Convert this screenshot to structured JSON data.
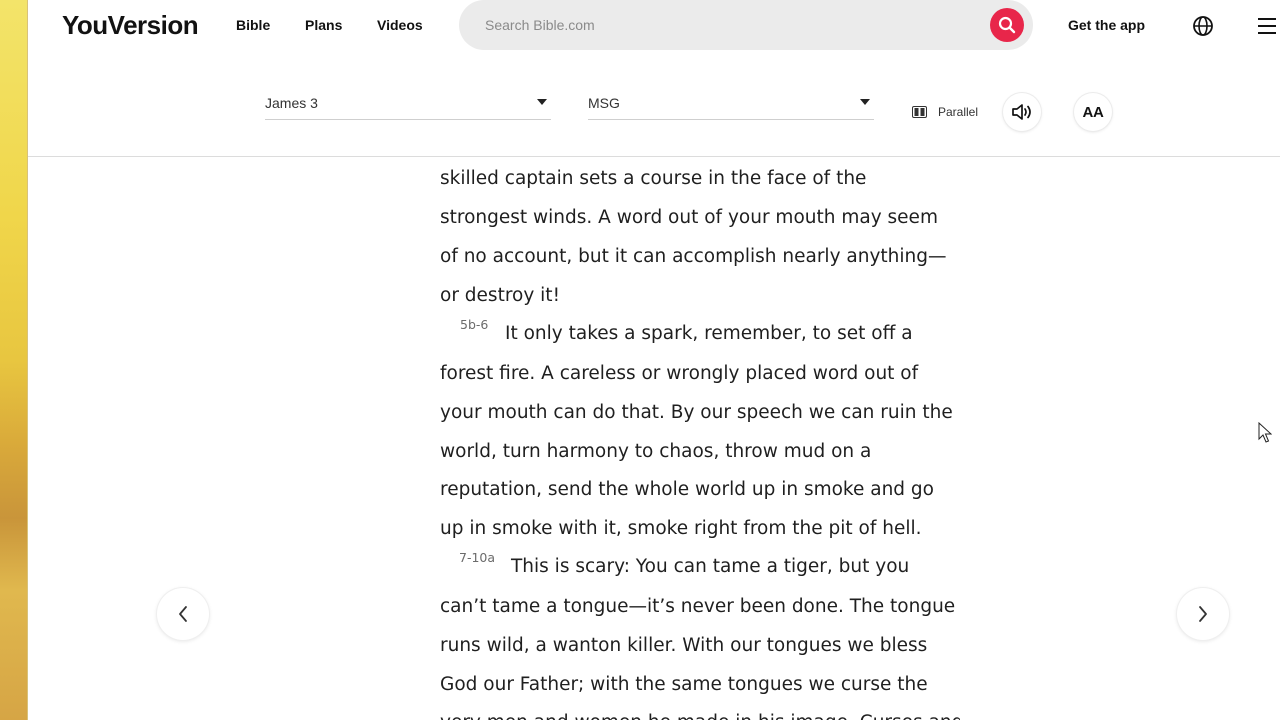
{
  "nav": {
    "logo": "YouVersion",
    "links": [
      "Bible",
      "Plans",
      "Videos"
    ],
    "search_placeholder": "Search Bible.com",
    "get_app": "Get the app"
  },
  "reader": {
    "book_chapter": "James 3",
    "version": "MSG",
    "parallel_label": "Parallel",
    "font_button": "AA"
  },
  "passage": {
    "lines": [
      "skilled captain sets a course in the face of the",
      "strongest winds. A word out of your mouth may seem",
      "of no account, but it can accomplish nearly anything—",
      "or destroy it!",
      "It only takes a spark, remember, to set off a",
      "forest fire. A careless or wrongly placed word out of",
      "your mouth can do that. By our speech we can ruin the",
      "world, turn harmony to chaos, throw mud on a",
      "reputation, send the whole world up in smoke and go",
      "up in smoke with it, smoke right from the pit of hell.",
      "This is scary: You can tame a tiger, but you",
      "can’t tame a tongue—it’s never been done. The tongue",
      "runs wild, a wanton killer. With our tongues we bless",
      "God our Father; with the same tongues we curse the",
      "very men and women he made in his image. Curses and"
    ],
    "verse_numbers": [
      "5b-6",
      "7-10a"
    ]
  },
  "colors": {
    "accent": "#e8264a",
    "search_bg": "#ebebeb"
  }
}
